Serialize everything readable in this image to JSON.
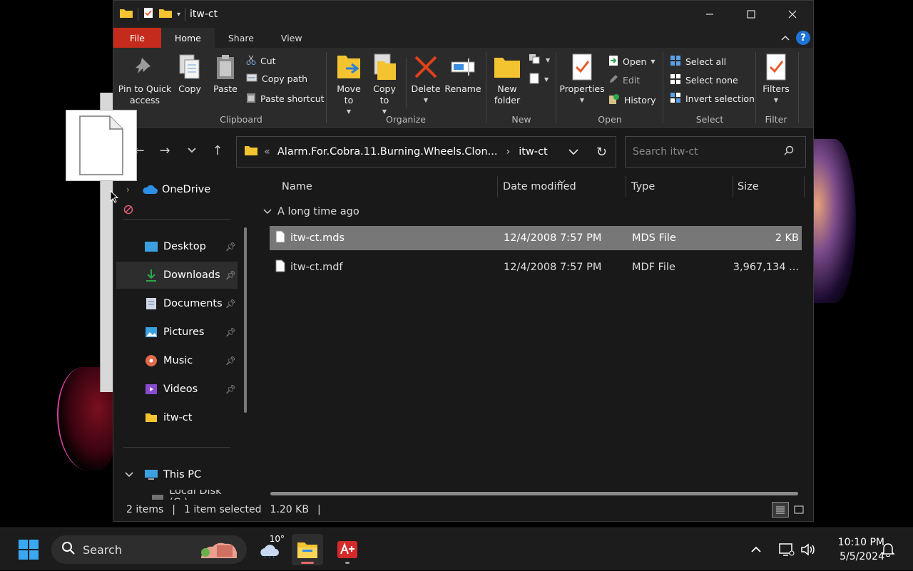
{
  "window": {
    "title": "itw-ct",
    "tabs": [
      "File",
      "Home",
      "Share",
      "View"
    ],
    "help_label": "?"
  },
  "ribbon": {
    "clipboard": {
      "label": "Clipboard",
      "pin": "Pin to Quick access",
      "copy": "Copy",
      "paste": "Paste",
      "cut": "Cut",
      "copy_path": "Copy path",
      "paste_shortcut": "Paste shortcut"
    },
    "organize": {
      "label": "Organize",
      "move_to": "Move to",
      "copy_to": "Copy to",
      "delete": "Delete",
      "rename": "Rename"
    },
    "new": {
      "label": "New",
      "new_folder": "New folder"
    },
    "open": {
      "label": "Open",
      "properties": "Properties",
      "open": "Open",
      "edit": "Edit",
      "history": "History"
    },
    "select": {
      "label": "Select",
      "select_all": "Select all",
      "select_none": "Select none",
      "invert": "Invert selection"
    },
    "filter": {
      "label": "Filter",
      "filters": "Filters"
    }
  },
  "address": {
    "prefix": "«",
    "segment1": "Alarm.For.Cobra.11.Burning.Wheels.Clon...",
    "segment2": "itw-ct",
    "search_placeholder": "Search itw-ct"
  },
  "nav": {
    "onedrive": "OneDrive",
    "items": [
      {
        "label": "Desktop",
        "pinned": true
      },
      {
        "label": "Downloads",
        "pinned": true
      },
      {
        "label": "Documents",
        "pinned": true
      },
      {
        "label": "Pictures",
        "pinned": true
      },
      {
        "label": "Music",
        "pinned": true
      },
      {
        "label": "Videos",
        "pinned": true
      },
      {
        "label": "itw-ct",
        "pinned": false
      }
    ],
    "this_pc": "This PC",
    "local_disk": "Local Disk (C:)"
  },
  "columns": {
    "name": "Name",
    "date": "Date modified",
    "type": "Type",
    "size": "Size"
  },
  "group_header": "A long time ago",
  "files": [
    {
      "name": "itw-ct.mds",
      "date": "12/4/2008 7:57 PM",
      "type": "MDS File",
      "size": "2 KB",
      "selected": true
    },
    {
      "name": "itw-ct.mdf",
      "date": "12/4/2008 7:57 PM",
      "type": "MDF File",
      "size": "3,967,134 ...",
      "selected": false
    }
  ],
  "status": {
    "items": "2 items",
    "selected": "1 item selected",
    "size": "1.20 KB"
  },
  "taskbar": {
    "search": "Search",
    "weather_temp": "10°",
    "time": "10:10 PM",
    "date": "5/5/2024"
  },
  "colors": {
    "file_tab": "#c42b1c",
    "accent": "#1e74d6",
    "folder": "#f4c430"
  }
}
